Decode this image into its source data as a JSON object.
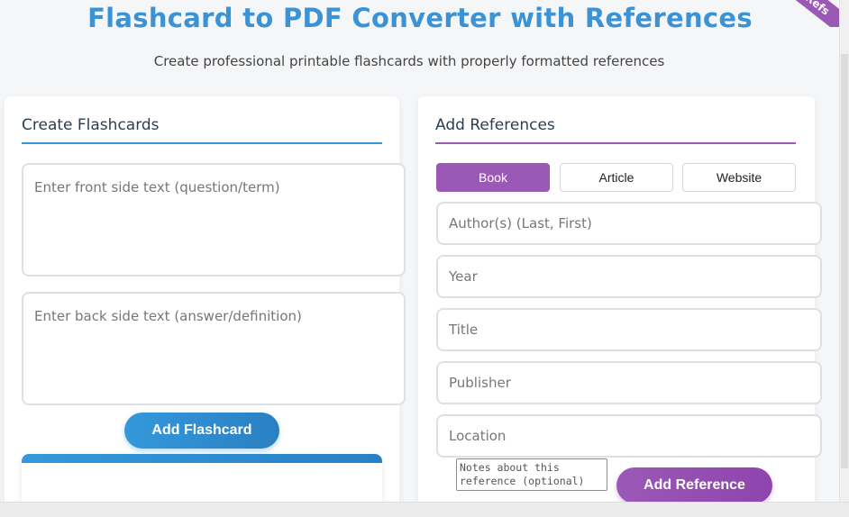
{
  "header": {
    "title": "Flashcard to PDF Converter with References",
    "subtitle": "Create professional printable flashcards with properly formatted references",
    "ribbon_label": "Refs"
  },
  "flashcards": {
    "title": "Create Flashcards",
    "front_placeholder": "Enter front side text (question/term)",
    "back_placeholder": "Enter back side text (answer/definition)",
    "add_button": "Add Flashcard"
  },
  "references": {
    "title": "Add References",
    "tabs": [
      {
        "label": "Book",
        "active": true
      },
      {
        "label": "Article",
        "active": false
      },
      {
        "label": "Website",
        "active": false
      }
    ],
    "fields": [
      {
        "placeholder": "Author(s) (Last, First)"
      },
      {
        "placeholder": "Year"
      },
      {
        "placeholder": "Title"
      },
      {
        "placeholder": "Publisher"
      },
      {
        "placeholder": "Location"
      }
    ],
    "notes_placeholder": "Notes about this reference (optional)",
    "add_button": "Add Reference"
  },
  "colors": {
    "primary": "#3b93d6",
    "accent": "#9b59b6"
  }
}
